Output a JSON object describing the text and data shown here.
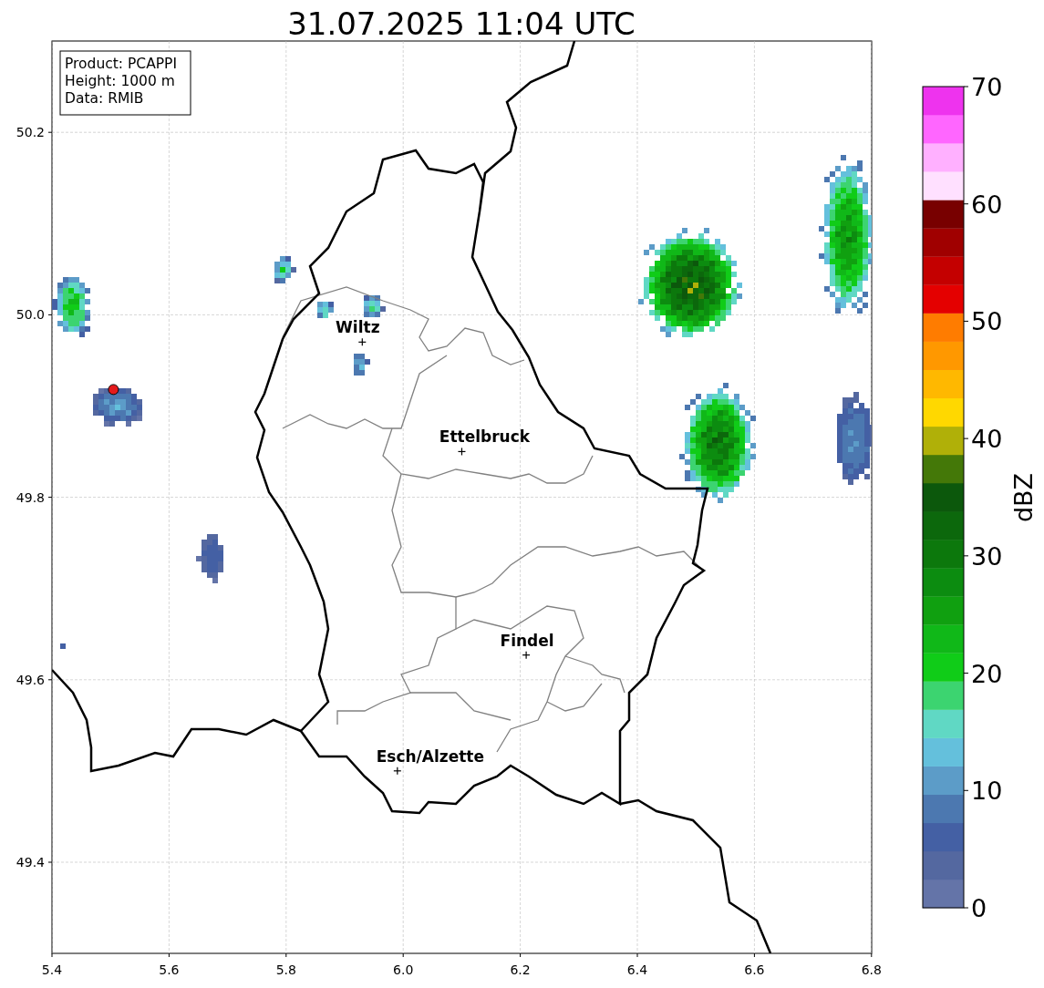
{
  "title": "31.07.2025 11:04 UTC",
  "info_box": [
    "Product: PCAPPI",
    "Height: 1000 m",
    "Data: RMIB"
  ],
  "map": {
    "xticks": [
      "5.4",
      "5.6",
      "5.8",
      "6.0",
      "6.2",
      "6.4",
      "6.6",
      "6.8"
    ],
    "yticks": [
      "50.2",
      "50.0",
      "49.8",
      "49.6",
      "49.4"
    ],
    "places": [
      "Wiltz",
      "Ettelbruck",
      "Findel",
      "Esch/Alzette"
    ]
  },
  "colorbar": {
    "label": "dBZ",
    "ticks": [
      "70",
      "60",
      "50",
      "40",
      "30",
      "20",
      "10",
      "0"
    ],
    "segments": [
      {
        "color": "#6474a8"
      },
      {
        "color": "#5468a0"
      },
      {
        "color": "#4460a4"
      },
      {
        "color": "#4c78b0"
      },
      {
        "color": "#5c9cc8"
      },
      {
        "color": "#64c0dc"
      },
      {
        "color": "#60d8c4"
      },
      {
        "color": "#3cd470"
      },
      {
        "color": "#10cc18"
      },
      {
        "color": "#10b818"
      },
      {
        "color": "#10a010"
      },
      {
        "color": "#0c8c10"
      },
      {
        "color": "#0c780c"
      },
      {
        "color": "#0c680c"
      },
      {
        "color": "#0c580c"
      },
      {
        "color": "#447808"
      },
      {
        "color": "#b0b008"
      },
      {
        "color": "#ffd800"
      },
      {
        "color": "#ffb800"
      },
      {
        "color": "#ff9800"
      },
      {
        "color": "#ff7c00"
      },
      {
        "color": "#e40000"
      },
      {
        "color": "#c40000"
      },
      {
        "color": "#a00000"
      },
      {
        "color": "#780000"
      },
      {
        "color": "#ffe0ff"
      },
      {
        "color": "#ffb0ff"
      },
      {
        "color": "#ff66ff"
      },
      {
        "color": "#ee33ee"
      }
    ]
  }
}
